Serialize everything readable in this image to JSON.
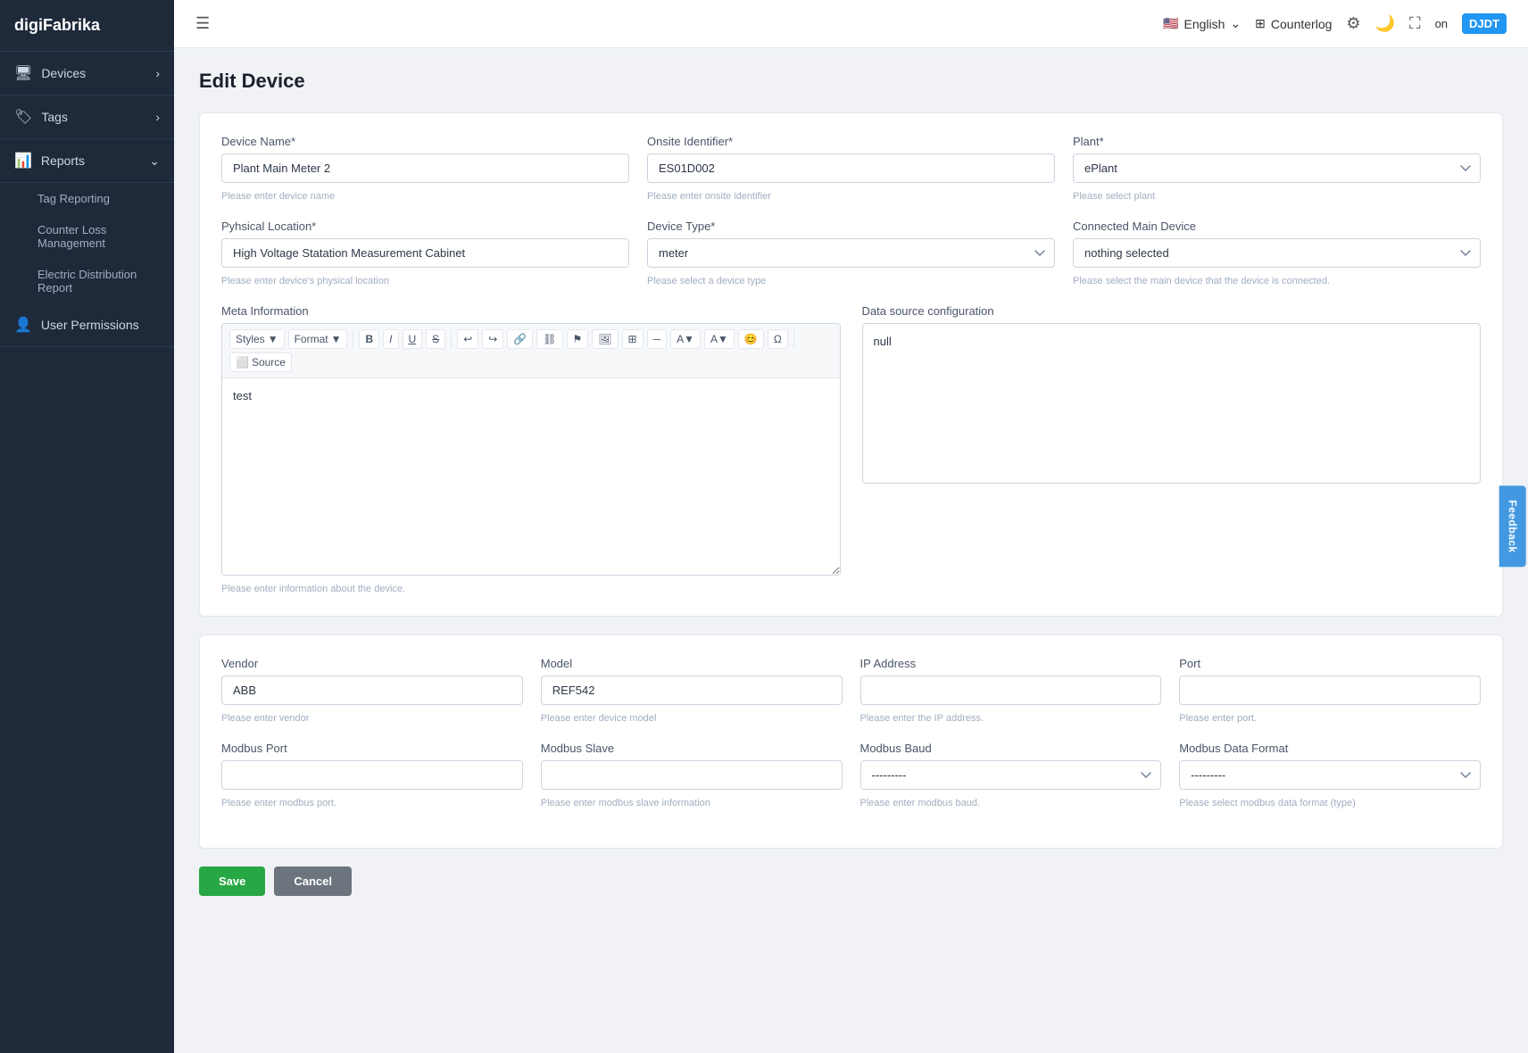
{
  "app": {
    "logo": "digiFabrika"
  },
  "sidebar": {
    "items": [
      {
        "id": "devices",
        "label": "Devices",
        "icon": "🖥",
        "hasArrow": true
      },
      {
        "id": "tags",
        "label": "Tags",
        "icon": "🏷",
        "hasArrow": true
      },
      {
        "id": "reports",
        "label": "Reports",
        "icon": "📊",
        "hasArrow": true
      }
    ],
    "reports_sub": [
      {
        "id": "tag-reporting",
        "label": "Tag Reporting"
      },
      {
        "id": "counter-loss",
        "label": "Counter Loss Management"
      },
      {
        "id": "electric-dist",
        "label": "Electric Distribution Report"
      }
    ],
    "user_permissions": {
      "label": "User Permissions",
      "icon": "👤"
    }
  },
  "topbar": {
    "menu_icon": "☰",
    "language": "English",
    "lang_flag": "🇺🇸",
    "counterlog": "Counterlog",
    "settings_icon": "⚙",
    "moon_icon": "🌙",
    "fullscreen_icon": "⛶",
    "on_label": "on",
    "user_badge": "DJDT"
  },
  "page": {
    "title": "Edit Device"
  },
  "form": {
    "device_name_label": "Device Name*",
    "device_name_value": "Plant Main Meter 2",
    "device_name_hint": "Please enter device name",
    "onsite_id_label": "Onsite Identifier*",
    "onsite_id_value": "ES01D002",
    "onsite_id_hint": "Please enter onsite identifier",
    "plant_label": "Plant*",
    "plant_value": "ePlant",
    "plant_hint": "Please select plant",
    "physical_location_label": "Pyhsical Location*",
    "physical_location_value": "High Voltage Statation Measurement Cabinet",
    "physical_location_hint": "Please enter device's physical location",
    "device_type_label": "Device Type*",
    "device_type_value": "meter",
    "device_type_hint": "Please select a device type",
    "connected_main_device_label": "Connected Main Device",
    "connected_main_device_value": "nothing selected",
    "connected_main_device_hint": "Please select the main device that the device is connected.",
    "meta_info_label": "Meta Information",
    "meta_info_content": "test",
    "meta_info_hint": "Please enter information about the device.",
    "data_source_label": "Data source configuration",
    "data_source_value": "null",
    "vendor_label": "Vendor",
    "vendor_value": "ABB",
    "vendor_hint": "Please enter vendor",
    "model_label": "Model",
    "model_value": "REF542",
    "model_hint": "Please enter device model",
    "ip_address_label": "IP Address",
    "ip_address_value": "",
    "ip_address_hint": "Please enter the IP address.",
    "port_label": "Port",
    "port_value": "",
    "port_hint": "Please enter port.",
    "modbus_port_label": "Modbus Port",
    "modbus_port_value": "",
    "modbus_port_hint": "Please enter modbus port.",
    "modbus_slave_label": "Modbus Slave",
    "modbus_slave_value": "",
    "modbus_slave_hint": "Please enter modbus slave information",
    "modbus_baud_label": "Modbus Baud",
    "modbus_baud_value": "---------",
    "modbus_baud_hint": "Please enter modbus baud.",
    "modbus_data_format_label": "Modbus Data Format",
    "modbus_data_format_value": "---------",
    "modbus_data_format_hint": "Please select modbus data format (type)"
  },
  "buttons": {
    "save": "Save",
    "cancel": "Cancel"
  },
  "rte_toolbar": {
    "styles": "Styles",
    "format": "Format",
    "bold": "B",
    "italic": "I",
    "underline": "U",
    "strikethrough": "S",
    "source": "Source"
  },
  "feedback": "Feedback"
}
